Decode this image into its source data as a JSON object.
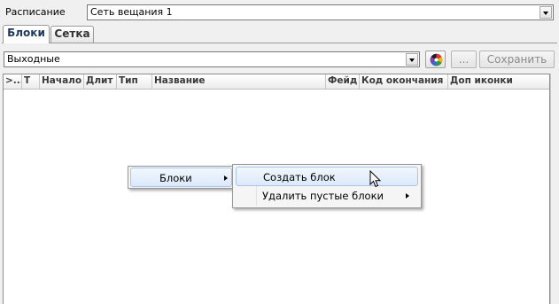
{
  "header": {
    "schedule_label": "Расписание",
    "schedule_value": "Сеть вещания 1"
  },
  "tabs": [
    {
      "label": "Блоки",
      "active": true
    },
    {
      "label": "Сетка",
      "active": false
    }
  ],
  "toolbar": {
    "day_value": "Выходные",
    "dots_label": "...",
    "save_label": "Сохранить"
  },
  "grid": {
    "columns": [
      ">...",
      "Т",
      "Начало",
      "Длит",
      "Тип",
      "Название",
      "Фейд",
      "Код окончания",
      "Доп иконки"
    ]
  },
  "context_menu": {
    "items": [
      "Блоки"
    ],
    "submenu": [
      "Создать блок",
      "Удалить пустые блоки"
    ]
  }
}
